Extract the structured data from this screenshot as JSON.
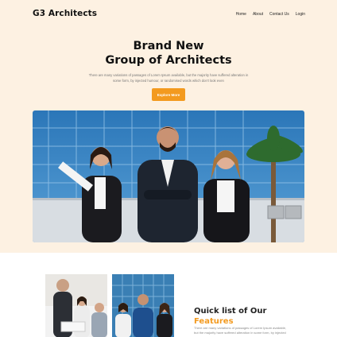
{
  "header": {
    "brand": "G3 Architects",
    "nav": [
      "Home",
      "About",
      "Contact Us",
      "Login"
    ]
  },
  "hero": {
    "title_line1": "Brand New",
    "title_line2": "Group of Architects",
    "subtitle_line1": "There are many variations of passages of Lorem Ipsum available, but the majority have suffered alteration in",
    "subtitle_line2": "some form, by injected humour, or randomised words which don't look even",
    "cta": "Explore More"
  },
  "features": {
    "title_part1": "Quick list",
    "title_part2": " of Our",
    "title_line2": "Features",
    "text_line1": "There are many variations of passages of Lorem Ipsum available,",
    "text_line2": "but the majority have suffered alteration in some form, by injected"
  },
  "colors": {
    "accent": "#f39a1f",
    "hero_bg": "#fdf1e2",
    "text_dark": "#111111"
  }
}
